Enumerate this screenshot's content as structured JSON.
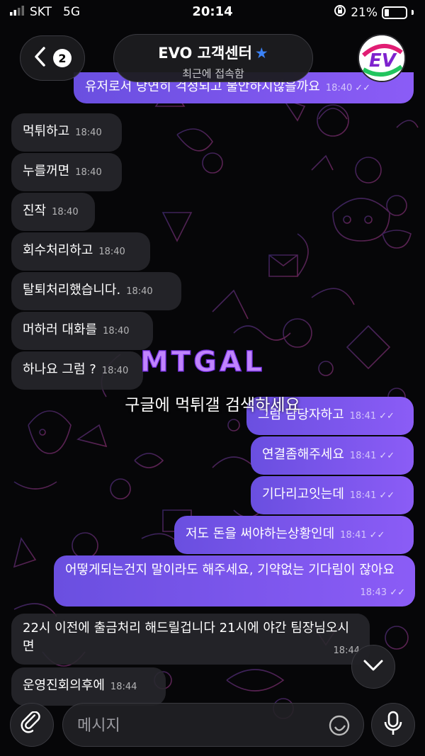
{
  "status_bar": {
    "carrier": "SKT",
    "network": "5G",
    "time": "20:14",
    "battery": "21%",
    "battery_level": 0.21
  },
  "header": {
    "back_badge": "2",
    "title": "EVO 고객센터",
    "subtitle": "최근에 접속함",
    "avatar_text": "EV"
  },
  "messages": [
    {
      "dir": "out",
      "text": "유저로서 당연히 걱정되고 불안하지않을까요",
      "time": "18:40"
    },
    {
      "dir": "in",
      "text": "먹튀하고",
      "time": "18:40"
    },
    {
      "dir": "in",
      "text": "누를꺼면",
      "time": "18:40"
    },
    {
      "dir": "in",
      "text": "진작",
      "time": "18:40"
    },
    {
      "dir": "in",
      "text": "회수처리하고",
      "time": "18:40"
    },
    {
      "dir": "in",
      "text": "탈퇴처리했습니다.",
      "time": "18:40"
    },
    {
      "dir": "in",
      "text": "머하러 대화를",
      "time": "18:40"
    },
    {
      "dir": "in",
      "text": "하나요 그럼 ?",
      "time": "18:40"
    },
    {
      "dir": "out",
      "text": "그럼 담당자하고",
      "time": "18:41"
    },
    {
      "dir": "out",
      "text": "연결좀해주세요",
      "time": "18:41"
    },
    {
      "dir": "out",
      "text": "기다리고잇는데",
      "time": "18:41"
    },
    {
      "dir": "out",
      "text": "저도 돈을 써야하는상황인데",
      "time": "18:41"
    },
    {
      "dir": "out",
      "text": "어떻게되는건지 말이라도 해주세요, 기약없는 기다림이 잖아요",
      "time": "18:43"
    },
    {
      "dir": "in",
      "text": "22시 이전에 출금처리 해드릴겁니다 21시에 야간 팀장님오시면",
      "time": "18:44"
    },
    {
      "dir": "in",
      "text": "운영진회의후에",
      "time": "18:44"
    }
  ],
  "watermark": {
    "logo": "MTGAL",
    "caption": "구글에 먹튀갤 검색하세요"
  },
  "composer": {
    "placeholder": "메시지"
  },
  "colors": {
    "outgoing_bubble": "#7b55ec",
    "incoming_bubble": "#28282c",
    "verified_star": "#3b82f6"
  }
}
